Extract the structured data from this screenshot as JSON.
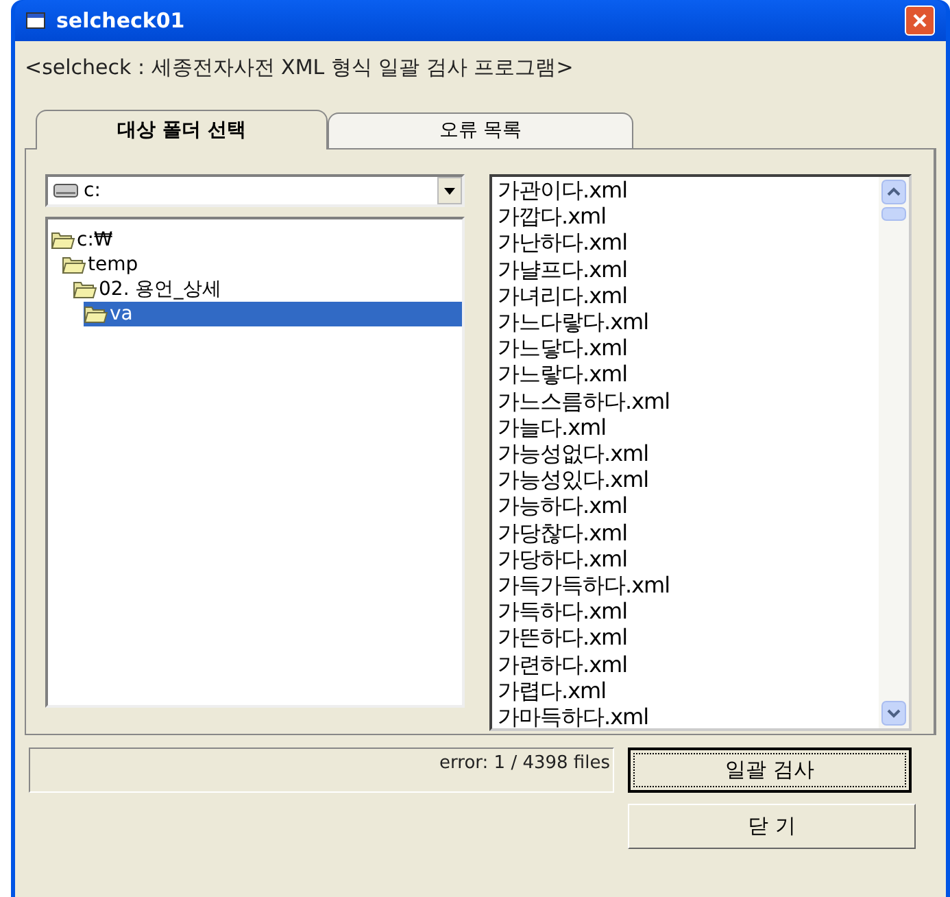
{
  "window": {
    "title": "selcheck01"
  },
  "subtitle": "<selcheck : 세종전자사전 XML 형식 일괄 검사 프로그램>",
  "tabs": [
    {
      "label": "대상 폴더 선택",
      "selected": true
    },
    {
      "label": "오류 목록",
      "selected": false
    }
  ],
  "drive": {
    "value": "c:"
  },
  "folders": [
    {
      "label": "c:₩",
      "selected": false,
      "children": [
        {
          "label": "temp",
          "selected": false,
          "children": [
            {
              "label": "02. 용언_상세",
              "selected": false,
              "children": [
                {
                  "label": "va",
                  "selected": true
                }
              ]
            }
          ]
        }
      ]
    }
  ],
  "files": [
    "가관이다.xml",
    "가깝다.xml",
    "가난하다.xml",
    "가냘프다.xml",
    "가녀리다.xml",
    "가느다랗다.xml",
    "가느닿다.xml",
    "가느랗다.xml",
    "가느스름하다.xml",
    "가늘다.xml",
    "가능성없다.xml",
    "가능성있다.xml",
    "가능하다.xml",
    "가당찮다.xml",
    "가당하다.xml",
    "가득가득하다.xml",
    "가득하다.xml",
    "가뜬하다.xml",
    "가련하다.xml",
    "가렵다.xml",
    "가마득하다.xml"
  ],
  "status": "error: 1 /  4398 files",
  "buttons": [
    "일괄 검사",
    "닫 기"
  ]
}
